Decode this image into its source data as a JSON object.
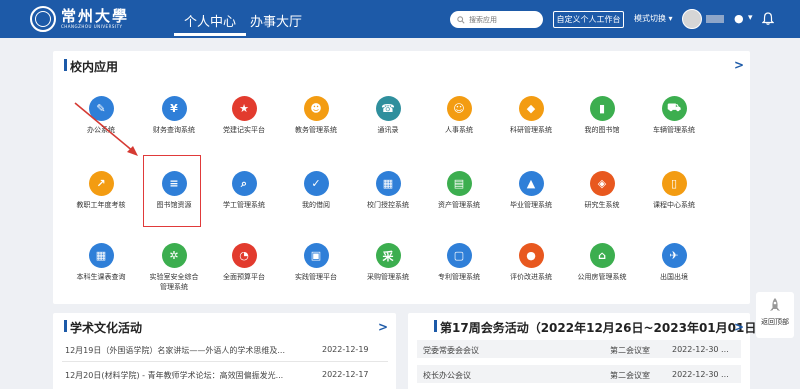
{
  "header": {
    "logo_cn": "常州大學",
    "logo_en": "CHANGZHOU UNIVERSITY",
    "tabs": [
      {
        "label": "个人中心",
        "active": true
      },
      {
        "label": "办事大厅",
        "active": false
      }
    ],
    "search_placeholder": "搜索应用",
    "custom_button": "自定义个人工作台",
    "mode_switch": "模式切换",
    "brand_color": "#1d5aa8"
  },
  "apps_section": {
    "title": "校内应用",
    "more": ">",
    "apps": [
      {
        "label": "办公系统",
        "icon": "pencil-icon",
        "color": "#2f7fd8"
      },
      {
        "label": "财务查询系统",
        "icon": "money-bag-icon",
        "color": "#2f7fd8"
      },
      {
        "label": "党建记实平台",
        "icon": "star-icon",
        "color": "#e23b2e"
      },
      {
        "label": "教务管理系统",
        "icon": "people-icon",
        "color": "#f39c12"
      },
      {
        "label": "通讯录",
        "icon": "contacts-icon",
        "color": "#2f8f9d"
      },
      {
        "label": "人事系统",
        "icon": "staff-icon",
        "color": "#f39c12"
      },
      {
        "label": "科研管理系统",
        "icon": "cube-icon",
        "color": "#f39c12"
      },
      {
        "label": "我的图书馆",
        "icon": "book-icon",
        "color": "#3cae4f"
      },
      {
        "label": "车辆管理系统",
        "icon": "car-icon",
        "color": "#3cae4f"
      },
      {
        "label": "教职工年度考核",
        "icon": "chart-up-icon",
        "color": "#f39c12"
      },
      {
        "label": "图书馆资源",
        "icon": "database-icon",
        "color": "#2f7fd8"
      },
      {
        "label": "学工管理系统",
        "icon": "document-search-icon",
        "color": "#2f7fd8"
      },
      {
        "label": "我的借阅",
        "icon": "clipboard-check-icon",
        "color": "#2f7fd8"
      },
      {
        "label": "校门授控系统",
        "icon": "building-icon",
        "color": "#2f7fd8"
      },
      {
        "label": "资产管理系统",
        "icon": "spreadsheet-icon",
        "color": "#3cae4f"
      },
      {
        "label": "毕业管理系统",
        "icon": "graduation-cap-icon",
        "color": "#2f7fd8"
      },
      {
        "label": "研究生系统",
        "icon": "layers-icon",
        "color": "#e8581f"
      },
      {
        "label": "课程中心系统",
        "icon": "book-open-icon",
        "color": "#f39c12"
      },
      {
        "label": "本科生课表查询",
        "icon": "grid-icon",
        "color": "#2f7fd8"
      },
      {
        "label": "实验室安全综合管理系统",
        "icon": "molecule-icon",
        "color": "#3cae4f"
      },
      {
        "label": "全面预算平台",
        "icon": "pie-chart-icon",
        "color": "#e23b2e"
      },
      {
        "label": "实践管理平台",
        "icon": "id-card-icon",
        "color": "#2f7fd8"
      },
      {
        "label": "采购管理系统",
        "icon": "cai-char-icon",
        "color": "#3cae4f"
      },
      {
        "label": "专利管理系统",
        "icon": "patent-icon",
        "color": "#2f7fd8"
      },
      {
        "label": "评价改进系统",
        "icon": "location-pin-icon",
        "color": "#e8581f"
      },
      {
        "label": "公用房管理系统",
        "icon": "house-icon",
        "color": "#3cae4f"
      },
      {
        "label": "出国出境",
        "icon": "passport-icon",
        "color": "#2f7fd8"
      }
    ]
  },
  "culture_section": {
    "title": "学术文化活动",
    "more": ">",
    "rows": [
      {
        "text": "12月19日（外国语学院）名家讲坛——外语人的学术思维及...",
        "date": "2022-12-19"
      },
      {
        "text": "12月20日(材料学院) - 青年教师学术论坛：高效固偏振发光...",
        "date": "2022-12-17"
      }
    ]
  },
  "meeting_section": {
    "title": "第17周会务活动（2022年12月26日~2023年01月01日）",
    "more": ">",
    "rows": [
      {
        "name": "党委常委会会议",
        "room": "第二会议室",
        "date": "2022-12-30 ..."
      },
      {
        "name": "校长办公会议",
        "room": "第二会议室",
        "date": "2022-12-30 ..."
      }
    ]
  },
  "back_to_top": "返回顶部"
}
